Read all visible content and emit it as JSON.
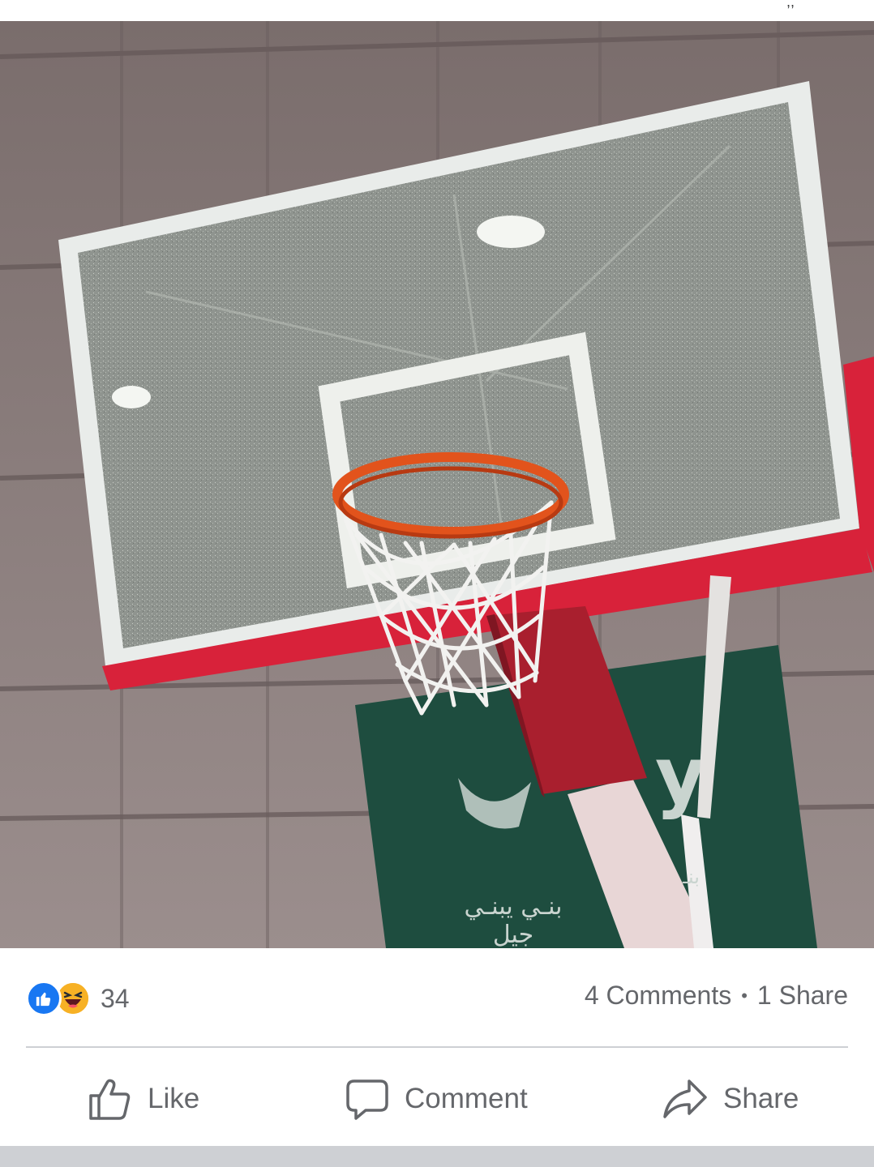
{
  "post": {
    "image_sign_text": "بنـي يبنـي جيل",
    "image_sign_text_right": "بنـ",
    "image_sign_logo_letter": "y"
  },
  "stats": {
    "reaction_count": "34",
    "comments": "4 Comments",
    "separator": "•",
    "shares": "1 Share"
  },
  "actions": {
    "like_label": "Like",
    "comment_label": "Comment",
    "share_label": "Share"
  },
  "icons": [
    "like-reaction-icon",
    "haha-reaction-icon",
    "thumbs-up-icon",
    "comment-bubble-icon",
    "share-arrow-icon"
  ],
  "colors": {
    "facebook_blue": "#1877f2",
    "haha_yellow": "#f7b125",
    "secondary_text": "#65676b",
    "divider": "#ced0d4",
    "hoop_red": "#d8223a"
  }
}
